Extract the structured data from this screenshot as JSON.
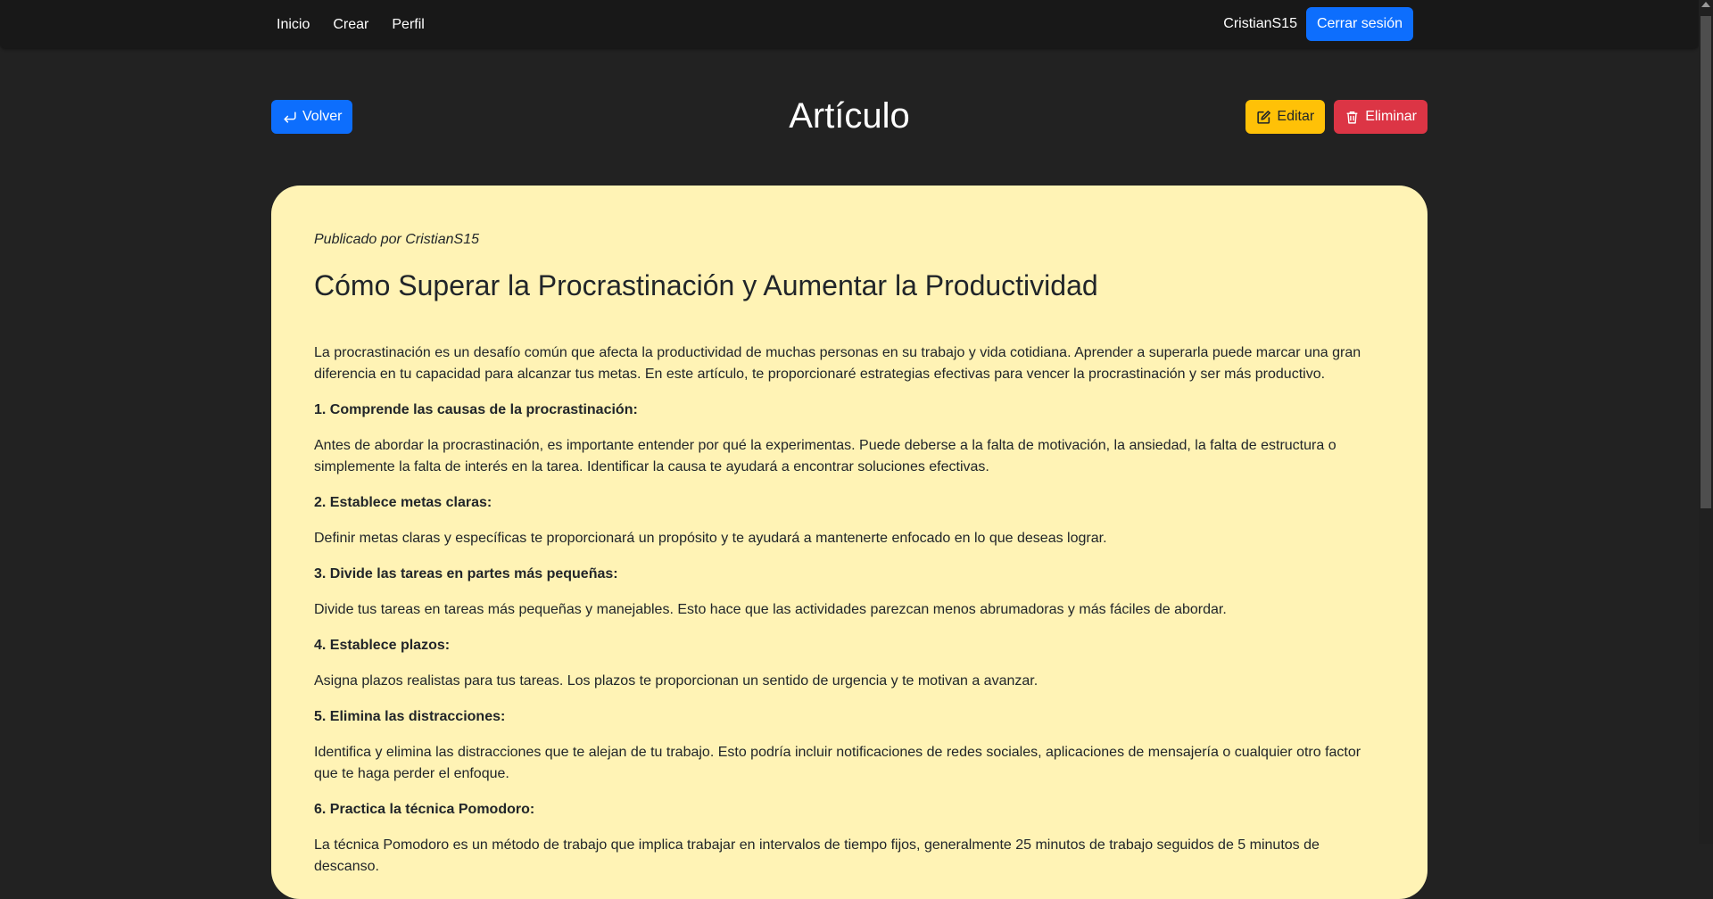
{
  "nav": {
    "links": [
      "Inicio",
      "Crear",
      "Perfil"
    ],
    "user": "CristianS15",
    "logout_label": "Cerrar sesión"
  },
  "header": {
    "back_label": "Volver",
    "title": "Artículo",
    "edit_label": "Editar",
    "delete_label": "Eliminar"
  },
  "article": {
    "author_line": "Publicado por CristianS15",
    "title": "Cómo Superar la Procrastinación y Aumentar la Productividad",
    "paragraphs": [
      "La procrastinación es un desafío común que afecta la productividad de muchas personas en su trabajo y vida cotidiana. Aprender a superarla puede marcar una gran diferencia en tu capacidad para alcanzar tus metas. En este artículo, te proporcionaré estrategias efectivas para vencer la procrastinación y ser más productivo.",
      "1. Comprende las causas de la procrastinación:",
      "Antes de abordar la procrastinación, es importante entender por qué la experimentas. Puede deberse a la falta de motivación, la ansiedad, la falta de estructura o simplemente la falta de interés en la tarea. Identificar la causa te ayudará a encontrar soluciones efectivas.",
      "2. Establece metas claras:",
      "Definir metas claras y específicas te proporcionará un propósito y te ayudará a mantenerte enfocado en lo que deseas lograr.",
      "3. Divide las tareas en partes más pequeñas:",
      "Divide tus tareas en tareas más pequeñas y manejables. Esto hace que las actividades parezcan menos abrumadoras y más fáciles de abordar.",
      "4. Establece plazos:",
      "Asigna plazos realistas para tus tareas. Los plazos te proporcionan un sentido de urgencia y te motivan a avanzar.",
      "5. Elimina las distracciones:",
      "Identifica y elimina las distracciones que te alejan de tu trabajo. Esto podría incluir notificaciones de redes sociales, aplicaciones de mensajería o cualquier otro factor que te haga perder el enfoque.",
      "6. Practica la técnica Pomodoro:",
      "La técnica Pomodoro es un método de trabajo que implica trabajar en intervalos de tiempo fijos, generalmente 25 minutos de trabajo seguidos de 5 minutos de descanso."
    ]
  },
  "icons": {
    "back": "return-arrow-icon",
    "edit": "pencil-square-icon",
    "delete": "trash-icon"
  },
  "colors": {
    "background": "#222222",
    "navbar": "#181818",
    "primary": "#0d6efd",
    "warning": "#ffc107",
    "danger": "#dc3545",
    "card": "#fff3b5"
  }
}
